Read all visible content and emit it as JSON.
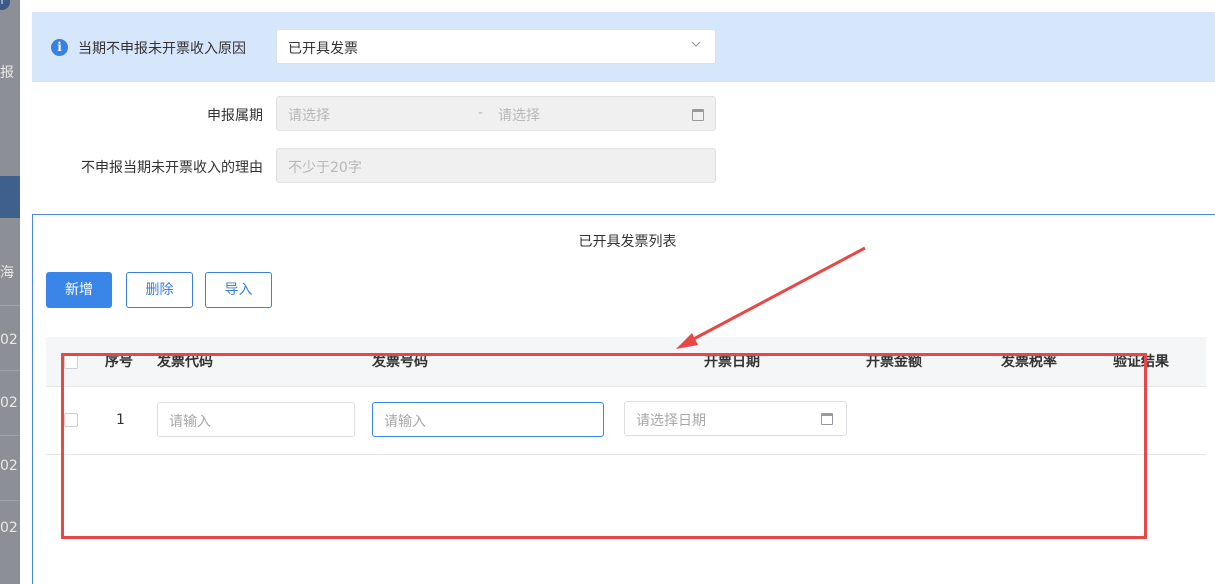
{
  "left_strip": {
    "fragments": [
      "报",
      "海",
      "02",
      "02",
      "02",
      "02"
    ]
  },
  "banner": {
    "label": "当期不申报未开票收入原因",
    "select_value": "已开具发票"
  },
  "form": {
    "period_label": "申报属期",
    "period_start_placeholder": "请选择",
    "period_sep": "-",
    "period_end_placeholder": "请选择",
    "reason_label": "不申报当期未开票收入的理由",
    "reason_placeholder": "不少于20字"
  },
  "table_section": {
    "title": "已开具发票列表",
    "buttons": {
      "add": "新增",
      "delete": "删除",
      "import": "导入"
    },
    "columns": [
      "序号",
      "发票代码",
      "发票号码",
      "开票日期",
      "开票金额",
      "发票税率",
      "验证结果"
    ],
    "rows": [
      {
        "index": "1",
        "code_placeholder": "请输入",
        "number_placeholder": "请输入",
        "date_placeholder": "请选择日期"
      }
    ]
  },
  "colors": {
    "banner_bg": "#d6e6fb",
    "primary": "#3a86e8",
    "annotation_red": "#e84747"
  }
}
